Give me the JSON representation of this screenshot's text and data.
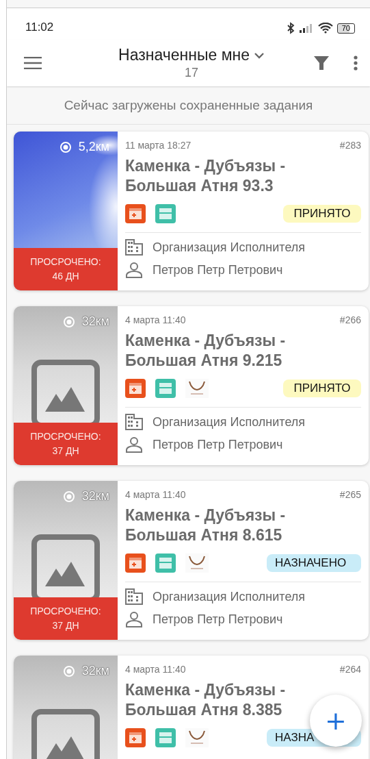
{
  "status_bar": {
    "time": "11:02",
    "battery": "70"
  },
  "app_bar": {
    "title": "Назначенные мне",
    "count": "17"
  },
  "banner": "Сейчас загружены сохраненные задания",
  "tasks": [
    {
      "image": {
        "kind": "picture"
      },
      "distance": "5,2км",
      "overdue": "ПРОСРОЧЕНО:\n46 ДН",
      "date": "11 марта 18:27",
      "number": "#283",
      "title": "Каменка - Дубъязы - Большая Атня 93.3",
      "tags": [
        {
          "kind": "doc-add"
        },
        {
          "kind": "doc"
        }
      ],
      "status": {
        "kind": "accepted",
        "label": "ПРИНЯТО"
      },
      "organization": "Организация Исполнителя",
      "person": "Петров Петр Петрович"
    },
    {
      "image": {
        "kind": "placeholder"
      },
      "distance": "32км",
      "overdue": "ПРОСРОЧЕНО:\n37 ДН",
      "date": "4 марта 11:40",
      "number": "#266",
      "title": "Каменка - Дубъязы - Большая Атня 9.215",
      "tags": [
        {
          "kind": "doc-add"
        },
        {
          "kind": "doc"
        },
        {
          "kind": "logo"
        }
      ],
      "status": {
        "kind": "accepted",
        "label": "ПРИНЯТО"
      },
      "organization": "Организация Исполнителя",
      "person": "Петров Петр Петрович"
    },
    {
      "image": {
        "kind": "placeholder"
      },
      "distance": "32км",
      "overdue": "ПРОСРОЧЕНО:\n37 ДН",
      "date": "4 марта 11:40",
      "number": "#265",
      "title": "Каменка - Дубъязы - Большая Атня 8.615",
      "tags": [
        {
          "kind": "doc-add"
        },
        {
          "kind": "doc"
        },
        {
          "kind": "logo"
        }
      ],
      "status": {
        "kind": "assigned",
        "label": "НАЗНАЧЕНО"
      },
      "organization": "Организация Исполнителя",
      "person": "Петров Петр Петрович"
    },
    {
      "image": {
        "kind": "placeholder"
      },
      "distance": "32км",
      "date": "4 марта 11:40",
      "number": "#264",
      "title": "Каменка - Дубъязы - Большая Атня 8.385",
      "tags": [
        {
          "kind": "doc-add"
        },
        {
          "kind": "doc"
        },
        {
          "kind": "logo"
        }
      ],
      "status": {
        "kind": "assigned",
        "label": "НАЗНА"
      }
    }
  ],
  "fab": "+"
}
